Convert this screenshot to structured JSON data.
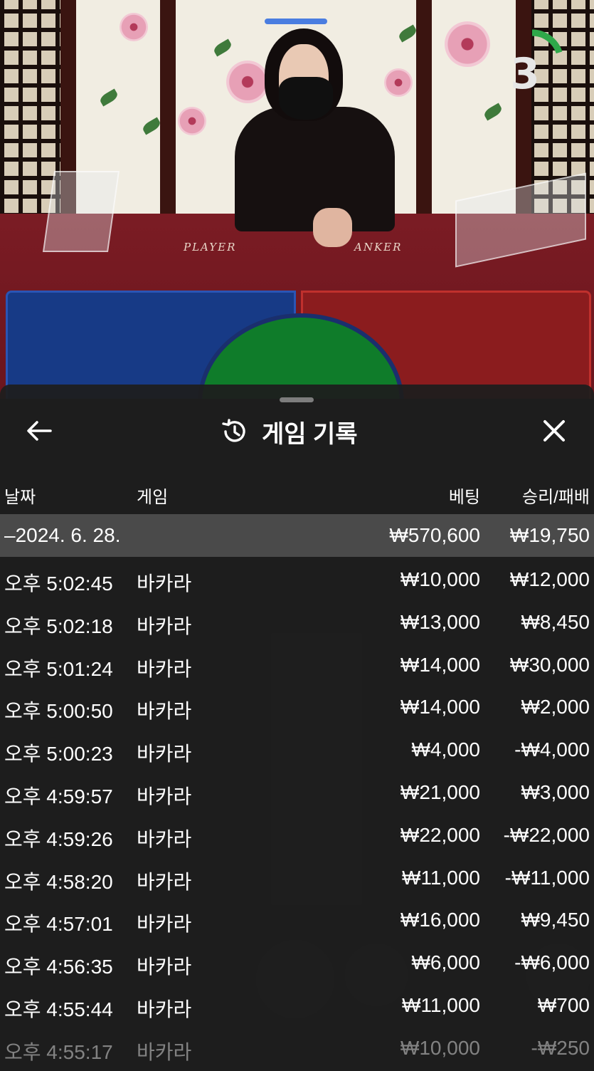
{
  "timer": {
    "value": "3",
    "color": "#2fa84a",
    "progress": 0.2
  },
  "table": {
    "player_label": "PLAYER",
    "banker_label": "ANKER"
  },
  "sheet": {
    "title": "게임 기록",
    "history_icon": "history-icon",
    "back_icon": "back-arrow-icon",
    "close_icon": "close-icon"
  },
  "columns": {
    "date": "날짜",
    "game": "게임",
    "bet": "베팅",
    "result": "승리/패배"
  },
  "date_group": {
    "date": "–2024. 6. 28.",
    "bet": "₩570,600",
    "result": "₩19,750"
  },
  "rows": [
    {
      "time": "오후 5:02:45",
      "game": "바카라",
      "bet": "₩10,000",
      "result": "₩12,000"
    },
    {
      "time": "오후 5:02:18",
      "game": "바카라",
      "bet": "₩13,000",
      "result": "₩8,450"
    },
    {
      "time": "오후 5:01:24",
      "game": "바카라",
      "bet": "₩14,000",
      "result": "₩30,000"
    },
    {
      "time": "오후 5:00:50",
      "game": "바카라",
      "bet": "₩14,000",
      "result": "₩2,000"
    },
    {
      "time": "오후 5:00:23",
      "game": "바카라",
      "bet": "₩4,000",
      "result": "-₩4,000"
    },
    {
      "time": "오후 4:59:57",
      "game": "바카라",
      "bet": "₩21,000",
      "result": "₩3,000"
    },
    {
      "time": "오후 4:59:26",
      "game": "바카라",
      "bet": "₩22,000",
      "result": "-₩22,000"
    },
    {
      "time": "오후 4:58:20",
      "game": "바카라",
      "bet": "₩11,000",
      "result": "-₩11,000"
    },
    {
      "time": "오후 4:57:01",
      "game": "바카라",
      "bet": "₩16,000",
      "result": "₩9,450"
    },
    {
      "time": "오후 4:56:35",
      "game": "바카라",
      "bet": "₩6,000",
      "result": "-₩6,000"
    },
    {
      "time": "오후 4:55:44",
      "game": "바카라",
      "bet": "₩11,000",
      "result": "₩700"
    },
    {
      "time": "오후 4:55:17",
      "game": "바카라",
      "bet": "₩10,000",
      "result": "-₩250"
    }
  ]
}
